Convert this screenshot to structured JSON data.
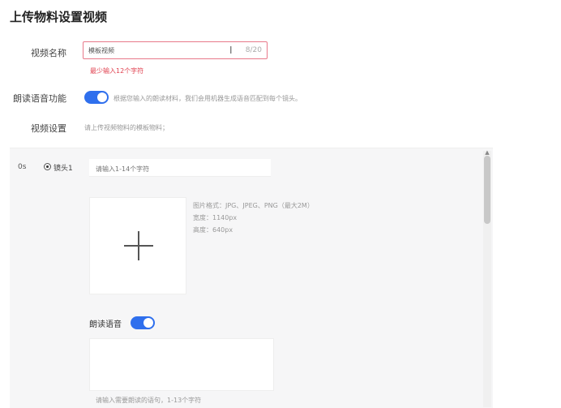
{
  "page": {
    "title": "上传物料设置视频"
  },
  "video_name": {
    "label": "视频名称",
    "value": "模板视频",
    "counter": "8/20",
    "error": "最少输入12个字符"
  },
  "read_voice": {
    "label": "朗读语音功能",
    "enabled": true,
    "hint": "根据您输入的朗读材料，我们会用机器生成语音匹配到每个镜头。"
  },
  "video_settings": {
    "label": "视频设置",
    "hint": "请上传视频物料的模板物料；"
  },
  "shot": {
    "time": "0s",
    "label": "镜头1",
    "input_placeholder": "请输入1-14个字符",
    "spec_format": "图片格式：JPG、JPEG、PNG（最大2M）",
    "spec_width": "宽度：1140px",
    "spec_height": "高度：640px",
    "voice_label": "朗读语音",
    "voice_enabled": true,
    "voice_hint": "请输入需要朗读的语句，1-13个字符"
  },
  "icons": {
    "cursor": "text-cursor-icon",
    "plus": "plus-icon",
    "radio": "radio-selected-icon"
  },
  "colors": {
    "accent": "#2f6fed",
    "error": "#e0404f",
    "panel_bg": "#f6f6f7"
  }
}
